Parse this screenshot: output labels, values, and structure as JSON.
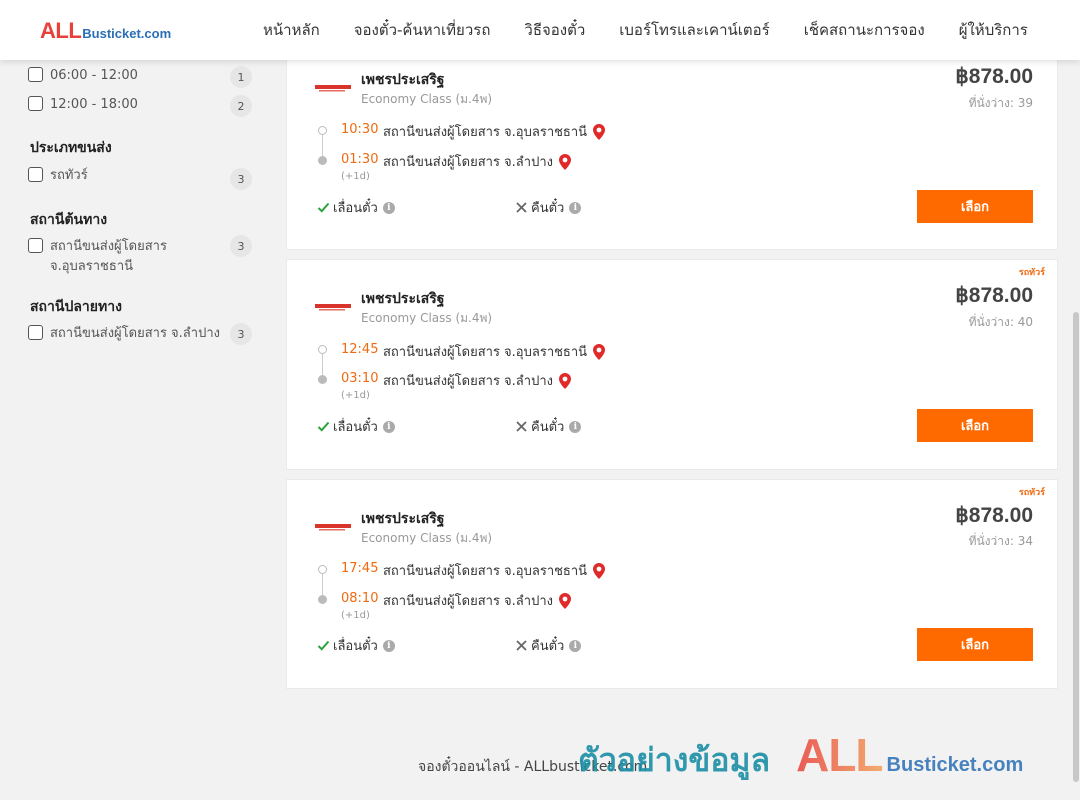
{
  "header": {
    "logo": {
      "all": "ALL",
      "rest": "Busticket.com"
    },
    "nav": [
      "หน้าหลัก",
      "จองตั๋ว-ค้นหาเที่ยวรถ",
      "วิธีจองตั๋ว",
      "เบอร์โทรและเคาน์เตอร์",
      "เช็คสถานะการจอง",
      "ผู้ให้บริการ"
    ]
  },
  "sidebar": {
    "time_filters": [
      {
        "label": "06:00 - 12:00",
        "count": "1"
      },
      {
        "label": "12:00 - 18:00",
        "count": "2"
      }
    ],
    "vehicle_type": {
      "title": "ประเภทขนส่ง",
      "items": [
        {
          "label": "รถทัวร์",
          "count": "3"
        }
      ]
    },
    "origin": {
      "title": "สถานีต้นทาง",
      "items": [
        {
          "label": "สถานีขนส่งผู้โดยสาร จ.อุบลราชธานี",
          "count": "3"
        }
      ]
    },
    "destination": {
      "title": "สถานีปลายทาง",
      "items": [
        {
          "label": "สถานีขนส่งผู้โดยสาร จ.ลำปาง",
          "count": "3"
        }
      ]
    }
  },
  "trips": [
    {
      "type_tag": "",
      "operator": "เพชรประเสริฐ",
      "class": "Economy Class (ม.4พ)",
      "price": "฿878.00",
      "seats": "ที่นั่งว่าง: 39",
      "depart_time": "10:30",
      "depart_station": "สถานีขนส่งผู้โดยสาร จ.อุบลราชธานี",
      "arrive_time": "01:30",
      "arrive_station": "สถานีขนส่งผู้โดยสาร จ.ลำปาง",
      "plus_day": "(+1d)",
      "reschedule": "เลื่อนตั๋ว",
      "refund": "คืนตั๋ว",
      "select": "เลือก"
    },
    {
      "type_tag": "รถทัวร์",
      "operator": "เพชรประเสริฐ",
      "class": "Economy Class (ม.4พ)",
      "price": "฿878.00",
      "seats": "ที่นั่งว่าง: 40",
      "depart_time": "12:45",
      "depart_station": "สถานีขนส่งผู้โดยสาร จ.อุบลราชธานี",
      "arrive_time": "03:10",
      "arrive_station": "สถานีขนส่งผู้โดยสาร จ.ลำปาง",
      "plus_day": "(+1d)",
      "reschedule": "เลื่อนตั๋ว",
      "refund": "คืนตั๋ว",
      "select": "เลือก"
    },
    {
      "type_tag": "รถทัวร์",
      "operator": "เพชรประเสริฐ",
      "class": "Economy Class (ม.4พ)",
      "price": "฿878.00",
      "seats": "ที่นั่งว่าง: 34",
      "depart_time": "17:45",
      "depart_station": "สถานีขนส่งผู้โดยสาร จ.อุบลราชธานี",
      "arrive_time": "08:10",
      "arrive_station": "สถานีขนส่งผู้โดยสาร จ.ลำปาง",
      "plus_day": "(+1d)",
      "reschedule": "เลื่อนตั๋ว",
      "refund": "คืนตั๋ว",
      "select": "เลือก"
    }
  ],
  "footer": {
    "text": "จองตั๋วออนไลน์ - ALLbusticket.com"
  },
  "watermark": {
    "thai": "ตัวอย่างข้อมูล",
    "all": "ALL",
    "rest": "Busticket.com"
  },
  "colors": {
    "accent": "#ff6a00",
    "time": "#f06a10",
    "brand_blue": "#2a6fb6",
    "brand_red": "#e8403b"
  }
}
